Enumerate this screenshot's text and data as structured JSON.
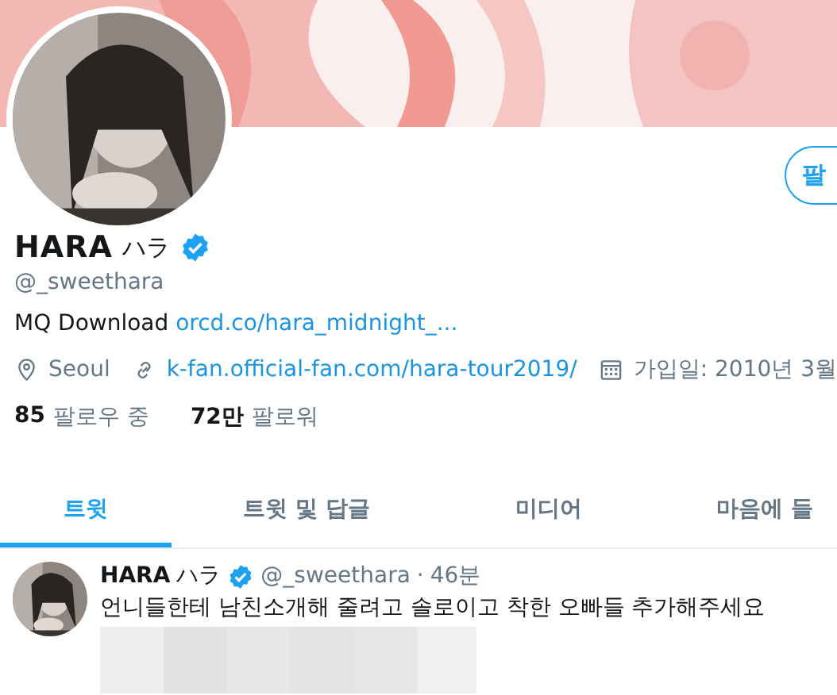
{
  "follow_button": {
    "label": "팔"
  },
  "profile": {
    "name": "HARA",
    "name_suffix": "ハラ",
    "verified": true,
    "handle": "@_sweethara",
    "bio": "MQ Download",
    "bio_link": "orcd.co/hara_midnight_...",
    "location": "Seoul",
    "website": "k-fan.official-fan.com/hara-tour2019/",
    "joined": "가입일: 2010년 3월"
  },
  "stats": [
    {
      "count": "85",
      "label": "팔로우 중"
    },
    {
      "count": "72만",
      "label": "팔로워"
    }
  ],
  "tabs": [
    {
      "label": "트윗",
      "selected": true
    },
    {
      "label": "트윗 및 답글",
      "selected": false
    },
    {
      "label": "미디어",
      "selected": false
    },
    {
      "label": "마음에 들",
      "selected": false
    }
  ],
  "tweet": {
    "name": "HARA",
    "name_suffix": "ハラ",
    "verified": true,
    "handle": "@_sweethara",
    "separator": "·",
    "time": "46분",
    "text": "언니들한테 남친소개해 줄려고 솔로이고 착한 오빠들 추가해주세요"
  }
}
